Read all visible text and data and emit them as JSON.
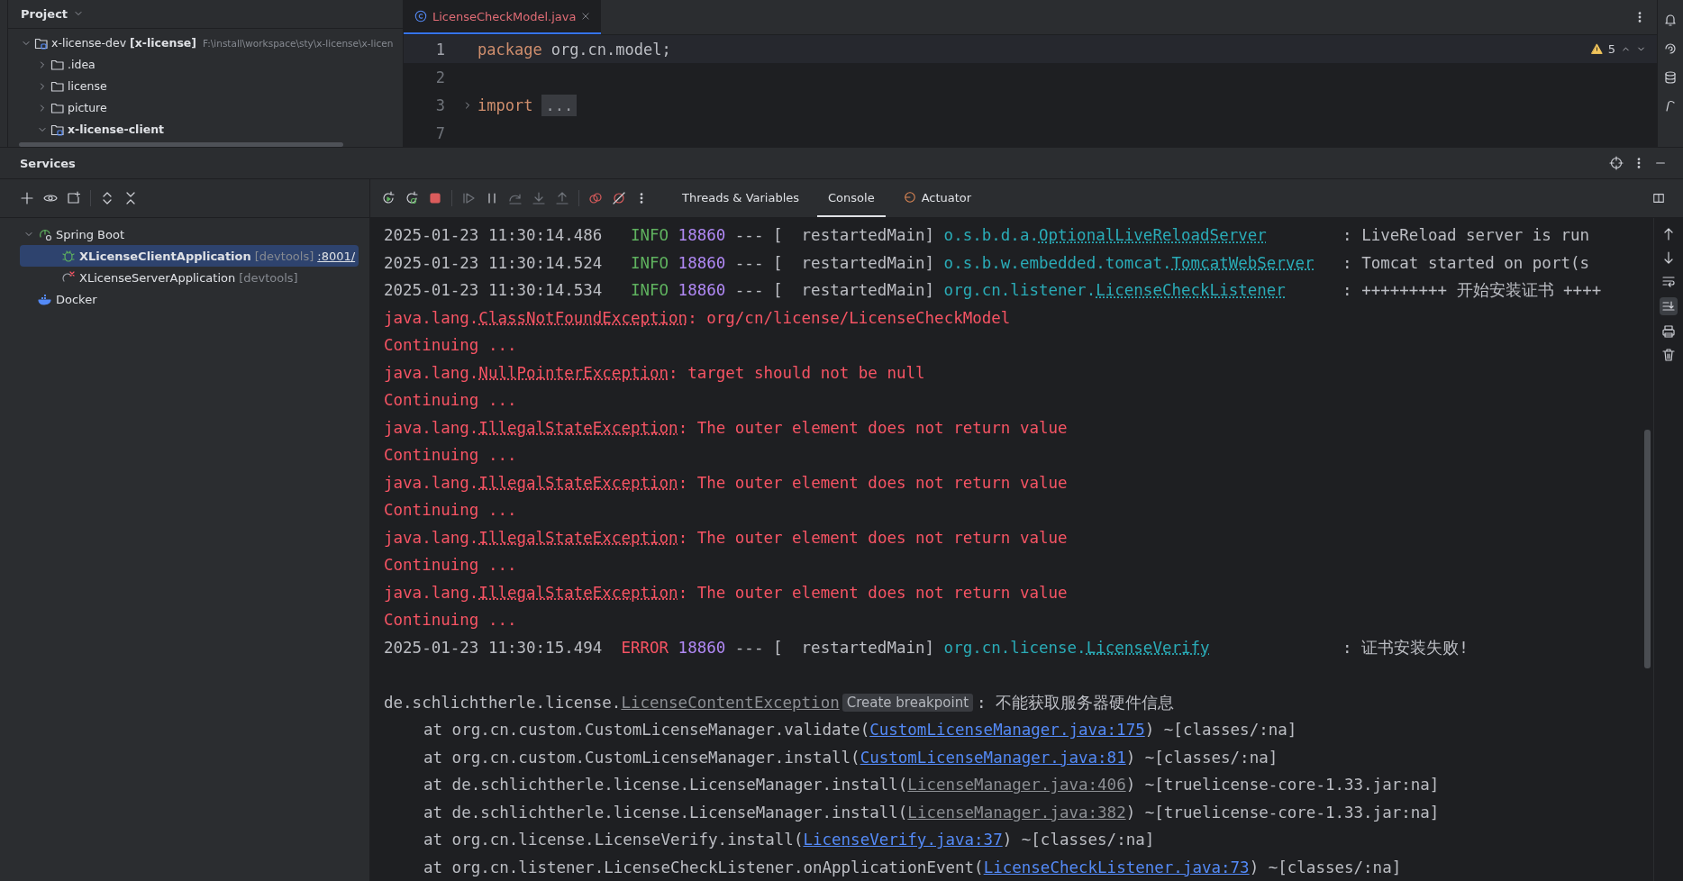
{
  "project": {
    "title": "Project",
    "tree": [
      {
        "label": "x-license-dev **[x-license]**",
        "path": "F:\\install\\workspace\\sty\\x-license\\x-licen",
        "kind": "module",
        "bold": false,
        "expanded": true,
        "children": [
          {
            "label": ".idea",
            "kind": "folder",
            "bold": false,
            "expanded": false
          },
          {
            "label": "license",
            "kind": "folder",
            "bold": false,
            "expanded": false
          },
          {
            "label": "picture",
            "kind": "folder",
            "bold": false,
            "expanded": false
          },
          {
            "label": "x-license-client",
            "kind": "module",
            "bold": true,
            "expanded": true
          }
        ]
      }
    ]
  },
  "editor": {
    "tab": {
      "label": "LicenseCheckModel.java"
    },
    "warnings": "5",
    "lines": [
      {
        "number": "1",
        "current": true,
        "folded": false,
        "tokens": [
          {
            "kind": "keyword",
            "text": "package"
          },
          {
            "kind": "plain",
            "text": "org.cn.model;"
          }
        ]
      },
      {
        "number": "2",
        "current": false,
        "folded": false
      },
      {
        "number": "3",
        "current": false,
        "folded": true,
        "tokens": [
          {
            "kind": "keyword",
            "text": "import"
          },
          {
            "kind": "fold",
            "text": "..."
          }
        ]
      },
      {
        "number": "7",
        "current": false,
        "folded": false
      }
    ]
  },
  "services": {
    "title": "Services",
    "tree": [
      {
        "label": "Spring Boot",
        "kind": "group",
        "expanded": true,
        "selected": false,
        "children": [
          {
            "label": "XLicenseClientApplication",
            "tag": "[devtools]",
            "port": ":8001/",
            "kind": "app",
            "running": true,
            "selected": true
          },
          {
            "label": "XLicenseServerApplication",
            "tag": "[devtools]",
            "kind": "app",
            "running": false,
            "selected": false
          }
        ]
      },
      {
        "label": "Docker",
        "kind": "docker",
        "selected": false
      }
    ],
    "tabs": [
      {
        "label": "Threads & Variables",
        "selected": false
      },
      {
        "label": "Console",
        "selected": true
      },
      {
        "label": "Actuator",
        "selected": false,
        "icon": true
      }
    ],
    "console": [
      {
        "kind": "log",
        "error": false,
        "time": "2025-01-23 11:30:14.486",
        "level": "INFO",
        "pid": "18860",
        "thread": "--- [  restartedMain]",
        "logger_package": "o.s.b.d.a.",
        "logger_class": "OptionalLiveReloadServer",
        "message": ": LiveReload server is run"
      },
      {
        "kind": "log",
        "error": false,
        "time": "2025-01-23 11:30:14.524",
        "level": "INFO",
        "pid": "18860",
        "thread": "--- [  restartedMain]",
        "logger_package": "o.s.b.w.embedded.tomcat.",
        "logger_class": "TomcatWebServer",
        "message": ": Tomcat started on port(s"
      },
      {
        "kind": "log",
        "error": false,
        "time": "2025-01-23 11:30:14.534",
        "level": "INFO",
        "pid": "18860",
        "thread": "--- [  restartedMain]",
        "logger_package": "org.cn.listener.",
        "logger_class": "LicenseCheckListener",
        "message": ": +++++++++ 开始安装证书 ++++"
      },
      {
        "kind": "text",
        "segments": [
          {
            "kind": "red",
            "text": "java.lang."
          },
          {
            "kind": "red_link",
            "text": "ClassNotFoundException"
          },
          {
            "kind": "red",
            "text": ": org/cn/license/LicenseCheckModel"
          }
        ]
      },
      {
        "kind": "text",
        "segments": [
          {
            "kind": "red",
            "text": "Continuing ..."
          }
        ]
      },
      {
        "kind": "text",
        "segments": [
          {
            "kind": "red",
            "text": "java.lang."
          },
          {
            "kind": "red_link",
            "text": "NullPointerException"
          },
          {
            "kind": "red",
            "text": ": target should not be null"
          }
        ]
      },
      {
        "kind": "text",
        "segments": [
          {
            "kind": "red",
            "text": "Continuing ..."
          }
        ]
      },
      {
        "kind": "text",
        "segments": [
          {
            "kind": "red",
            "text": "java.lang."
          },
          {
            "kind": "red_link",
            "text": "IllegalStateException"
          },
          {
            "kind": "red",
            "text": ": The outer element does not return value"
          }
        ]
      },
      {
        "kind": "text",
        "segments": [
          {
            "kind": "red",
            "text": "Continuing ..."
          }
        ]
      },
      {
        "kind": "text",
        "segments": [
          {
            "kind": "red",
            "text": "java.lang."
          },
          {
            "kind": "red_link",
            "text": "IllegalStateException"
          },
          {
            "kind": "red",
            "text": ": The outer element does not return value"
          }
        ]
      },
      {
        "kind": "text",
        "segments": [
          {
            "kind": "red",
            "text": "Continuing ..."
          }
        ]
      },
      {
        "kind": "text",
        "segments": [
          {
            "kind": "red",
            "text": "java.lang."
          },
          {
            "kind": "red_link",
            "text": "IllegalStateException"
          },
          {
            "kind": "red",
            "text": ": The outer element does not return value"
          }
        ]
      },
      {
        "kind": "text",
        "segments": [
          {
            "kind": "red",
            "text": "Continuing ..."
          }
        ]
      },
      {
        "kind": "text",
        "segments": [
          {
            "kind": "red",
            "text": "java.lang."
          },
          {
            "kind": "red_link",
            "text": "IllegalStateException"
          },
          {
            "kind": "red",
            "text": ": The outer element does not return value"
          }
        ]
      },
      {
        "kind": "text",
        "segments": [
          {
            "kind": "red",
            "text": "Continuing ..."
          }
        ]
      },
      {
        "kind": "log",
        "error": true,
        "time": "2025-01-23 11:30:15.494",
        "level": "ERROR",
        "pid": "18860",
        "thread": "--- [  restartedMain]",
        "logger_package": "org.cn.license.",
        "logger_class": "LicenseVerify",
        "message": ": 证书安装失败!"
      },
      {
        "kind": "blank"
      },
      {
        "kind": "text",
        "segments": [
          {
            "kind": "plain",
            "text": "de.schlichtherle.license."
          },
          {
            "kind": "lib_link",
            "text": "LicenseContentException"
          },
          {
            "kind": "badge",
            "text": "Create breakpoint"
          },
          {
            "kind": "plain",
            "text": ": 不能获取服务器硬件信息"
          }
        ]
      },
      {
        "kind": "trace",
        "segments": [
          {
            "kind": "plain",
            "text": "at org.cn.custom.CustomLicenseManager.validate("
          },
          {
            "kind": "link",
            "text": "CustomLicenseManager.java:175"
          },
          {
            "kind": "plain",
            "text": ") ~[classes/:na]"
          }
        ]
      },
      {
        "kind": "trace",
        "segments": [
          {
            "kind": "plain",
            "text": "at org.cn.custom.CustomLicenseManager.install("
          },
          {
            "kind": "link",
            "text": "CustomLicenseManager.java:81"
          },
          {
            "kind": "plain",
            "text": ") ~[classes/:na]"
          }
        ]
      },
      {
        "kind": "trace",
        "segments": [
          {
            "kind": "plain",
            "text": "at de.schlichtherle.license.LicenseManager.install("
          },
          {
            "kind": "lib_link",
            "text": "LicenseManager.java:406"
          },
          {
            "kind": "plain",
            "text": ") ~[truelicense-core-1.33.jar:na]"
          }
        ]
      },
      {
        "kind": "trace",
        "segments": [
          {
            "kind": "plain",
            "text": "at de.schlichtherle.license.LicenseManager.install("
          },
          {
            "kind": "lib_link",
            "text": "LicenseManager.java:382"
          },
          {
            "kind": "plain",
            "text": ") ~[truelicense-core-1.33.jar:na]"
          }
        ]
      },
      {
        "kind": "trace",
        "segments": [
          {
            "kind": "plain",
            "text": "at org.cn.license.LicenseVerify.install("
          },
          {
            "kind": "link",
            "text": "LicenseVerify.java:37"
          },
          {
            "kind": "plain",
            "text": ") ~[classes/:na]"
          }
        ]
      },
      {
        "kind": "trace",
        "segments": [
          {
            "kind": "plain",
            "text": "at org.cn.listener.LicenseCheckListener.onApplicationEvent("
          },
          {
            "kind": "link",
            "text": "LicenseCheckListener.java:73"
          },
          {
            "kind": "plain",
            "text": ") ~[classes/:na]"
          }
        ]
      }
    ]
  }
}
